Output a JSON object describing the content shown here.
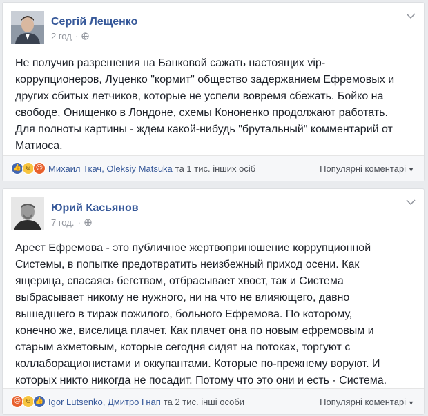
{
  "posts": [
    {
      "author": "Сергій Лещенко",
      "time": "2 год",
      "text_lines": [
        "Не получив разрешения на Банковой сажать настоящих vip-",
        "коррупционеров, Луценко \"кормит\" общество задержанием Ефремовых и",
        "других сбитых летчиков, которые не успели вовремя сбежать. Бойко на",
        "свободе, Онищенко в Лондоне, схемы Кононенко продолжают работать.",
        "Для полноты картины - ждем какой-нибудь \"брутальный\" комментарий от",
        "Матиоса."
      ],
      "reaction_names": "Михаил Ткач, Oleksiy Matsuka",
      "reaction_others": "та 1 тис. інших осіб",
      "sort_label": "Популярні коментарі"
    },
    {
      "author": "Юрий Касьянов",
      "time": "7 год.",
      "text_lines": [
        "Арест Ефремова - это публичное жертвоприношение коррупционной",
        "Системы, в попытке предотвратить неизбежный приход осени. Как",
        "ящерица, спасаясь бегством, отбрасывает хвост, так и Система",
        "выбрасывает никому не нужного, ни на что не влияющего, давно",
        "вышедшего в тираж пожилого, больного Ефремова. По которому,",
        "конечно же, виселица плачет. Как плачет она по новым ефремовым и",
        "старым ахметовым, которые сегодня сидят на потоках, торгуют с",
        "коллаборационистами и оккупантами. Которые по-прежнему воруют. И",
        "которых никто никогда не посадит. Потому что это они и есть - Система."
      ],
      "reaction_names": "Igor Lutsenko, Дмитро Гнап",
      "reaction_others": "та 2 тис. інші особи",
      "sort_label": "Популярні коментарі"
    }
  ],
  "icons": {
    "reactions": [
      "like-icon",
      "haha-icon",
      "angry-icon"
    ],
    "privacy": "globe-icon",
    "menu": "chevron-down-icon"
  },
  "colors": {
    "author": "#365899",
    "meta": "#90949c",
    "like": "#4267b2",
    "haha": "#f7c43f",
    "angry": "#e8602c"
  }
}
